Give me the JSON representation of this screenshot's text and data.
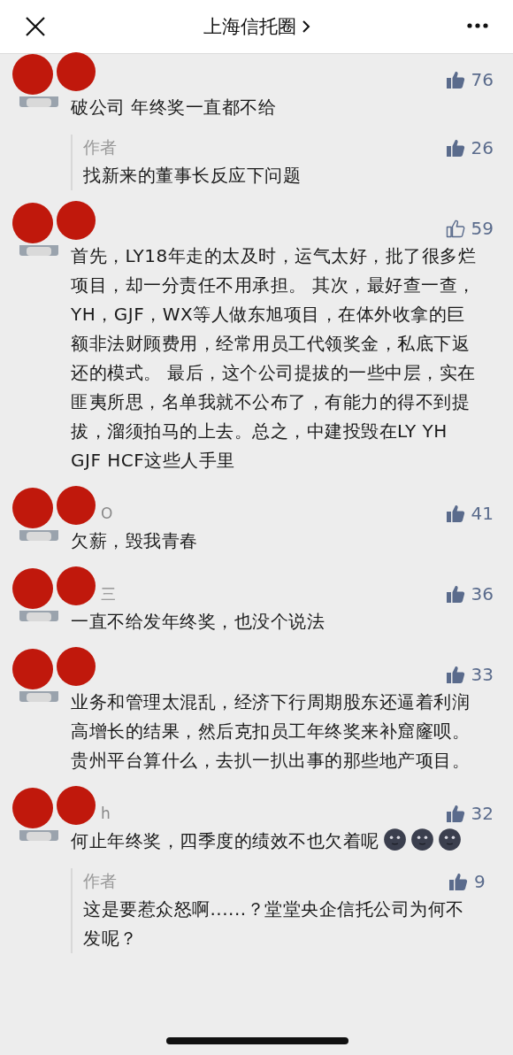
{
  "header": {
    "title": "上海信托圈"
  },
  "comments": [
    {
      "likes": "76",
      "liked": true,
      "text": "破公司 年终奖一直都不给",
      "reply": {
        "author": "作者",
        "likes": "26",
        "liked": true,
        "text": "找新来的董事长反应下问题"
      }
    },
    {
      "likes": "59",
      "liked": false,
      "text": "首先，LY18年走的太及时，运气太好，批了很多烂项目，却一分责任不用承担。 其次，最好查一查，YH，GJF，WX等人做东旭项目，在体外收拿的巨额非法财顾费用，经常用员工代领奖金，私底下返还的模式。 最后，这个公司提拔的一些中层，实在匪夷所思，名单我就不公布了，有能力的得不到提拔，溜须拍马的上去。总之，中建投毁在LY YH GJF HCF这些人手里"
    },
    {
      "name": "O",
      "likes": "41",
      "liked": true,
      "text": "欠薪，毁我青春"
    },
    {
      "name": "三",
      "likes": "36",
      "liked": true,
      "text": "一直不给发年终奖，也没个说法"
    },
    {
      "likes": "33",
      "liked": true,
      "text": "业务和管理太混乱，经济下行周期股东还逼着利润高增长的结果，然后克扣员工年终奖来补窟窿呗。贵州平台算什么，去扒一扒出事的那些地产项目。"
    },
    {
      "name": "h",
      "likes": "32",
      "liked": true,
      "text": "何止年终奖，四季度的绩效不也欠着呢",
      "emojis": [
        {
          "kind": "moon"
        },
        {
          "kind": "moon"
        },
        {
          "kind": "moon"
        }
      ],
      "reply": {
        "author": "作者",
        "likes": "9",
        "liked": true,
        "text": "这是要惹众怒啊......？堂堂央企信托公司为何不发呢？"
      }
    }
  ]
}
